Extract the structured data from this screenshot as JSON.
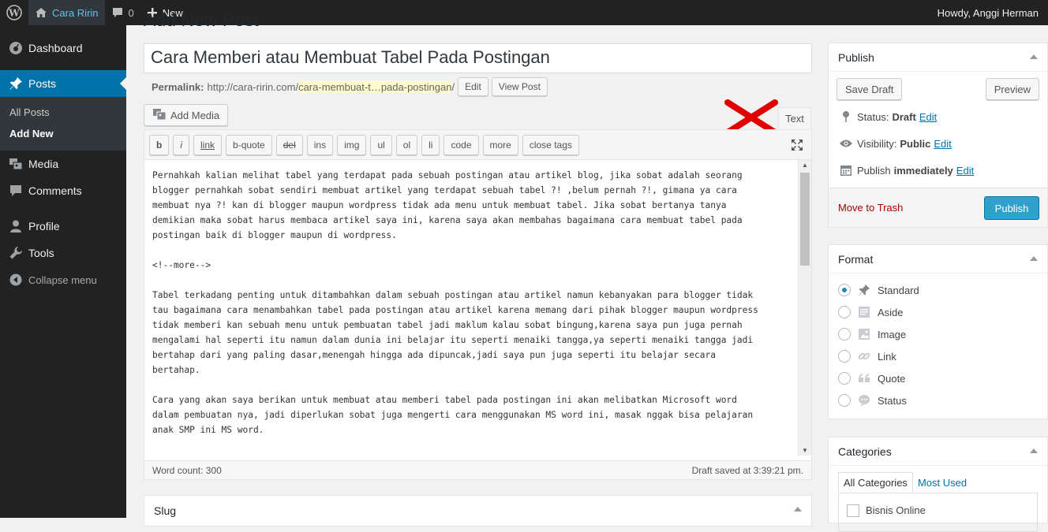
{
  "adminbar": {
    "site_name": "Cara Ririn",
    "comments_count": "0",
    "new_label": "New",
    "howdy": "Howdy, Anggi Herman"
  },
  "sidebar": {
    "dashboard": "Dashboard",
    "posts": "Posts",
    "all_posts": "All Posts",
    "add_new": "Add New",
    "media": "Media",
    "comments": "Comments",
    "profile": "Profile",
    "tools": "Tools",
    "collapse": "Collapse menu"
  },
  "page": {
    "heading": "Add New Post"
  },
  "post": {
    "title": "Cara Memberi atau Membuat Tabel Pada Postingan",
    "permalink_label": "Permalink:",
    "permalink_base": "http://cara-ririn.com/",
    "permalink_slug": "cara-membuat-t…pada-postingan",
    "permalink_end": "/",
    "edit_btn": "Edit",
    "view_btn": "View Post"
  },
  "editor": {
    "add_media": "Add Media",
    "tab_text": "Text",
    "buttons": [
      "b",
      "i",
      "link",
      "b-quote",
      "del",
      "ins",
      "img",
      "ul",
      "ol",
      "li",
      "code",
      "more",
      "close tags"
    ],
    "content": "Pernahkah kalian melihat tabel yang terdapat pada sebuah postingan atau artikel blog, jika sobat adalah seorang\nblogger pernahkah sobat sendiri membuat artikel yang terdapat sebuah tabel ?! ,belum pernah ?!, gimana ya cara\nmembuat nya ?! kan di blogger maupun wordpress tidak ada menu untuk membuat tabel. Jika sobat bertanya tanya\ndemikian maka sobat harus membaca artikel saya ini, karena saya akan membahas bagaimana cara membuat tabel pada\npostingan baik di blogger maupun di wordpress.\n\n<!--more-->\n\nTabel terkadang penting untuk ditambahkan dalam sebuah postingan atau artikel namun kebanyakan para blogger tidak\ntau bagaimana cara menambahkan tabel pada postingan atau artikel karena memang dari pihak blogger maupun wordpress\ntidak memberi kan sebuah menu untuk pembuatan tabel jadi maklum kalau sobat bingung,karena saya pun juga pernah\nmengalami hal seperti itu namun dalam dunia ini belajar itu seperti menaiki tangga,ya seperti menaiki tangga jadi\nbertahap dari yang paling dasar,menengah hingga ada dipuncak,jadi saya pun juga seperti itu belajar secara\nbertahap.\n\nCara yang akan saya berikan untuk membuat atau memberi tabel pada postingan ini akan melibatkan Microsoft word\ndalam pembuatan nya, jadi diperlukan sobat juga mengerti cara menggunakan MS word ini, masak nggak bisa pelajaran\nanak SMP ini MS word.\n\nDan berikut Cara Memberi atau Membuat Tabel Pada Postingan khusus untuk sahabat cara ririn yang saya cintai :D",
    "word_count": "Word count: 300",
    "draft_saved": "Draft saved at 3:39:21 pm."
  },
  "slug_box": {
    "title": "Slug"
  },
  "publish": {
    "title": "Publish",
    "save_draft": "Save Draft",
    "preview": "Preview",
    "status_label": "Status:",
    "status_value": "Draft",
    "visibility_label": "Visibility:",
    "visibility_value": "Public",
    "publish_label": "Publish",
    "publish_value": "immediately",
    "edit_link": "Edit",
    "trash": "Move to Trash",
    "publish_btn": "Publish"
  },
  "format": {
    "title": "Format",
    "options": [
      "Standard",
      "Aside",
      "Image",
      "Link",
      "Quote",
      "Status"
    ],
    "selected": "Standard"
  },
  "categories": {
    "title": "Categories",
    "tab_all": "All Categories",
    "tab_most": "Most Used",
    "first_item": "Bisnis Online"
  },
  "colors": {
    "accent": "#0073aa",
    "publish_btn": "#2ea2cc",
    "admin_dark": "#222222",
    "trash": "#aa0000",
    "red_x": "#e00000"
  }
}
